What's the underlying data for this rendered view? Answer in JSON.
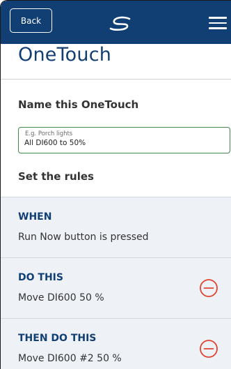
{
  "header": {
    "back_label": "Back",
    "logo_icon": "brand-swoosh-icon",
    "menu_icon": "hamburger-menu-icon",
    "bar_color": "#123f73"
  },
  "page_title": "OneTouch",
  "name_section": {
    "heading": "Name this OneTouch",
    "field_placeholder": "E.g. Porch lights",
    "field_value": "All DI600 to 50%"
  },
  "rules_section": {
    "heading": "Set the rules",
    "rules": [
      {
        "label": "WHEN",
        "description": "Run Now button is pressed",
        "removable": false
      },
      {
        "label": "DO THIS",
        "description": "Move DI600 50 %",
        "removable": true
      },
      {
        "label": "THEN DO THIS",
        "description": "Move DI600 #2 50 %",
        "removable": true
      }
    ]
  },
  "colors": {
    "accent": "#123f73",
    "remove": "#e0432f",
    "field_border": "#3d8a4a",
    "panel_bg": "#eef2f7"
  }
}
